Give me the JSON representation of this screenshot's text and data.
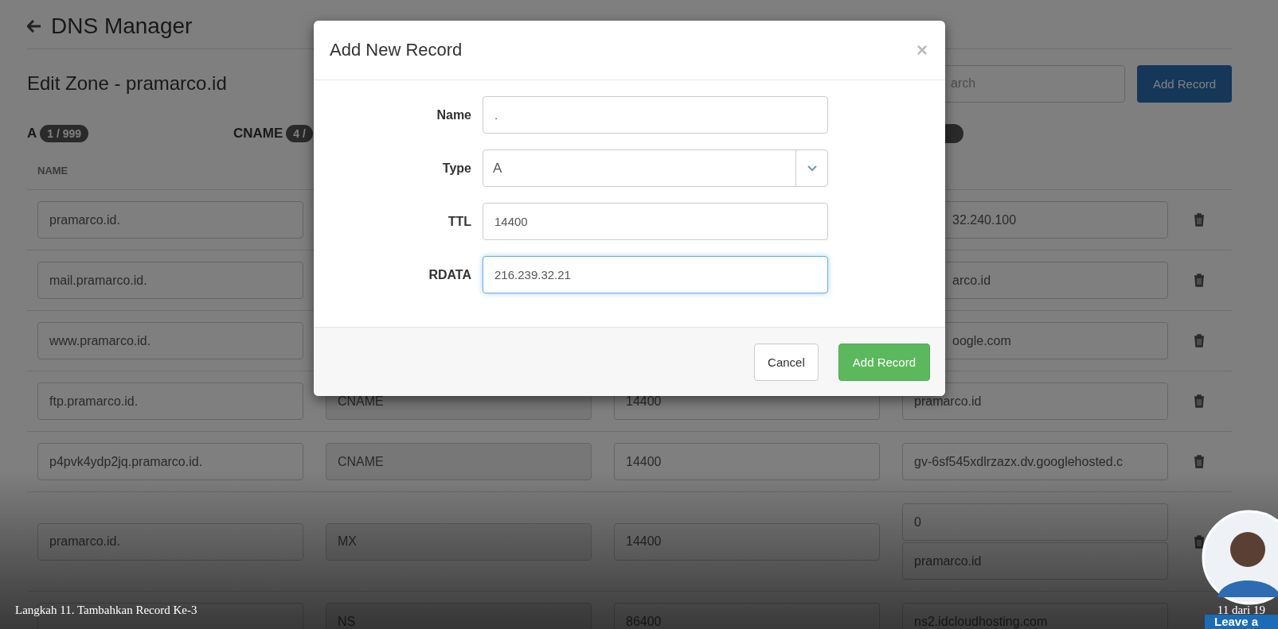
{
  "page": {
    "back_title": "DNS Manager",
    "zone_title": "Edit Zone - pramarco.id",
    "search": {
      "placeholder": "arch"
    },
    "add_button": "Add Record"
  },
  "tabs": [
    {
      "kind": "tab",
      "label": "A",
      "count": "1 / 999"
    },
    {
      "kind": "tab",
      "label": "CNAME",
      "count": "4 /"
    },
    {
      "kind": "badge-fragment"
    }
  ],
  "table": {
    "columns": [
      "NAME"
    ],
    "rows": [
      {
        "name": "pramarco.id.",
        "rdata": [
          "32.240.100"
        ],
        "deletable": true
      },
      {
        "name": "mail.pramarco.id.",
        "rdata": [
          "arco.id"
        ],
        "deletable": true
      },
      {
        "name": "www.pramarco.id.",
        "rdata": [
          "oogle.com"
        ],
        "deletable": true
      },
      {
        "name": "ftp.pramarco.id.",
        "type": "CNAME",
        "ttl": "14400",
        "rdata": [
          "pramarco.id"
        ],
        "deletable": true
      },
      {
        "name": "p4pvk4ydp2jq.pramarco.id.",
        "type": "CNAME",
        "ttl": "14400",
        "rdata": [
          "gv-6sf545xdlrzazx.dv.googlehosted.c"
        ],
        "deletable": true
      },
      {
        "name": "pramarco.id.",
        "type": "MX",
        "ttl": "14400",
        "rdata": [
          "0",
          "pramarco.id"
        ],
        "deletable": true
      },
      {
        "type": "NS",
        "ttl": "86400",
        "rdata": [
          "ns2.idcloudhosting.com"
        ],
        "deletable": false
      }
    ]
  },
  "modal": {
    "title": "Add New Record",
    "close": "×",
    "fields": [
      {
        "kind": "text",
        "label": "Name",
        "value": ".",
        "focused": false
      },
      {
        "kind": "select",
        "label": "Type",
        "value": "A",
        "focused": false
      },
      {
        "kind": "text",
        "label": "TTL",
        "value": "14400",
        "focused": false
      },
      {
        "kind": "text",
        "label": "RDATA",
        "value": "216.239.32.21",
        "focused": true
      }
    ],
    "buttons": [
      {
        "kind": "default",
        "label": "Cancel"
      },
      {
        "kind": "primary",
        "label": "Add Record"
      }
    ]
  },
  "caption": {
    "step": "Langkah 11. Tambahkan Record Ke-3",
    "progress": "11 dari 19"
  },
  "presenter": {
    "label": "Leave a"
  }
}
